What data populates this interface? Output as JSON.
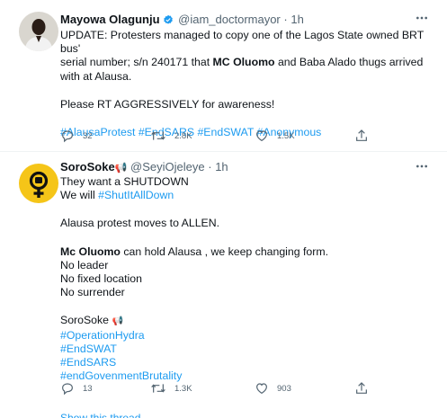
{
  "tweets": [
    {
      "display_name": "Mayowa Olagunju",
      "handle": "@iam_doctormayor",
      "time": "1h",
      "verified": true,
      "text_lines_1": "UPDATE: Protesters managed to copy one of the Lagos State owned BRT bus'",
      "text_lines_2a": "serial number; s/n 240171 that ",
      "text_lines_2b": "MC Oluomo",
      "text_lines_2c": " and Baba Alado thugs arrived",
      "text_lines_3": "with at Alausa.",
      "text_para2": "Please RT AGGRESSIVELY for awareness!",
      "hashtags": [
        "#AlausaProtest",
        "#EndSARS",
        "#EndSWAT",
        "#Anonymous"
      ],
      "replies": "32",
      "retweets": "2.8K",
      "likes": "1.5K"
    },
    {
      "display_name": "SoroSoke",
      "name_emoji": "📢",
      "handle": "@SeyiOjeleye",
      "time": "1h",
      "line1": "They want a SHUTDOWN",
      "line2a": "We will ",
      "line2b": "#ShutItAllDown",
      "line3": "Alausa protest moves to ALLEN.",
      "line4a": "Mc Oluomo",
      "line4b": " can hold Alausa , we keep changing form.",
      "line5": "No leader",
      "line6": "No fixed location",
      "line7": "No surrender",
      "line8": "SoroSoke",
      "line8_emoji": "📢",
      "hashtags": [
        "#OperationHydra",
        "#EndSWAT",
        "#EndSARS",
        "#endGovenmentBrutality"
      ],
      "replies": "13",
      "retweets": "1.3K",
      "likes": "903"
    }
  ],
  "show_thread": "Show this thread",
  "colors": {
    "link": "#1d9bf0",
    "muted": "#536471",
    "verified": "#1d9bf0",
    "avatar2_bg": "#f5c518"
  }
}
